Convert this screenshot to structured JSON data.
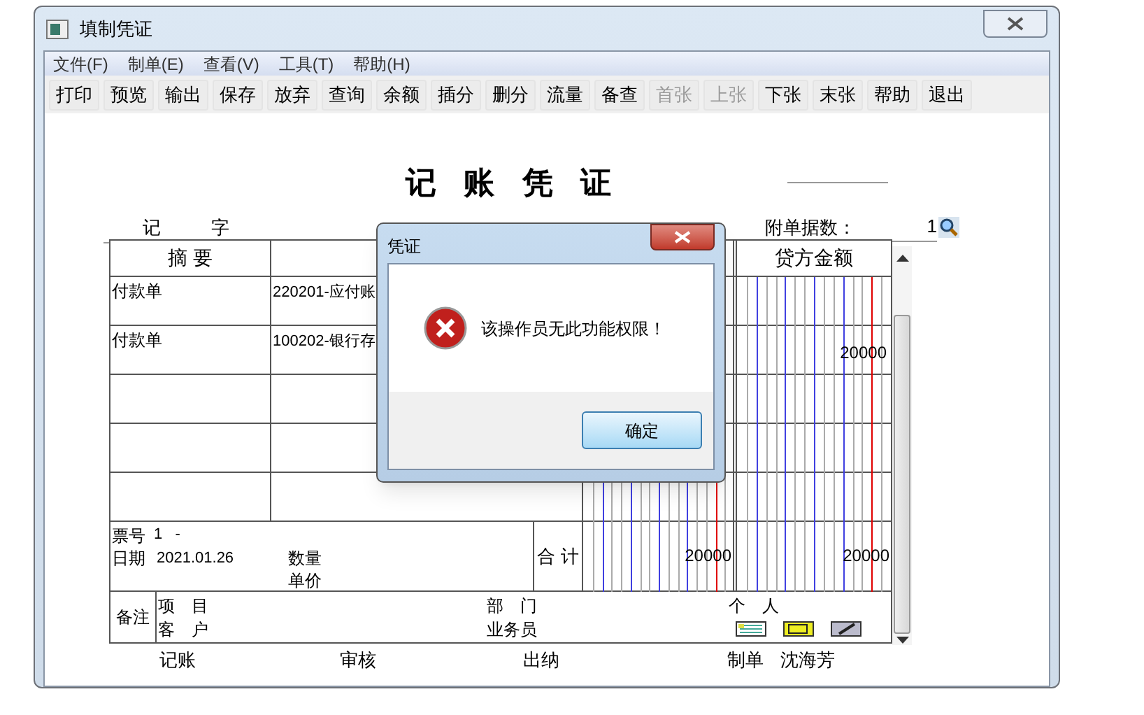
{
  "window": {
    "title": "填制凭证"
  },
  "menu": [
    "文件(F)",
    "制单(E)",
    "查看(V)",
    "工具(T)",
    "帮助(H)"
  ],
  "toolbar": [
    {
      "label": "打印",
      "disabled": false
    },
    {
      "label": "预览",
      "disabled": false
    },
    {
      "label": "输出",
      "disabled": false
    },
    {
      "label": "保存",
      "disabled": false
    },
    {
      "label": "放弃",
      "disabled": false
    },
    {
      "label": "查询",
      "disabled": false
    },
    {
      "label": "余额",
      "disabled": false
    },
    {
      "label": "插分",
      "disabled": false
    },
    {
      "label": "删分",
      "disabled": false
    },
    {
      "label": "流量",
      "disabled": false
    },
    {
      "label": "备查",
      "disabled": false
    },
    {
      "label": "首张",
      "disabled": true
    },
    {
      "label": "上张",
      "disabled": true
    },
    {
      "label": "下张",
      "disabled": false
    },
    {
      "label": "末张",
      "disabled": false
    },
    {
      "label": "帮助",
      "disabled": false
    },
    {
      "label": "退出",
      "disabled": false
    }
  ],
  "voucher": {
    "title": "记 账 凭 证",
    "type_char": "记",
    "type_suffix": "字",
    "attachments_label": "附单据数：",
    "attachments_value": "1",
    "columns": {
      "summary": "摘 要",
      "credit": "贷方金额"
    },
    "rows": [
      {
        "summary": "付款单",
        "account": "220201-应付账",
        "debit": "",
        "credit": ""
      },
      {
        "summary": "付款单",
        "account": "100202-银行存",
        "debit": "",
        "credit": "20000"
      },
      {
        "summary": "",
        "account": "",
        "debit": "",
        "credit": ""
      },
      {
        "summary": "",
        "account": "",
        "debit": "",
        "credit": ""
      },
      {
        "summary": "",
        "account": "",
        "debit": "",
        "credit": ""
      }
    ],
    "ticket_label": "票号",
    "ticket_value": "1   -",
    "date_field_label": "日期",
    "date_field_value": "2021.01.26",
    "quantity_label": "数量",
    "unit_price_label": "单价",
    "total_label": "合 计",
    "total_debit": "20000",
    "total_credit": "20000",
    "remarks_label": "备注",
    "project_label": "项　目",
    "customer_label": "客　户",
    "department_label": "部　门",
    "salesperson_label": "业务员",
    "person_label": "个　人",
    "signatures": [
      {
        "label": "记账"
      },
      {
        "label": "审核"
      },
      {
        "label": "出纳"
      },
      {
        "label": "制单",
        "value": "沈海芳"
      }
    ]
  },
  "dialog": {
    "title": "凭证",
    "message": "该操作员无此功能权限！",
    "ok_button": "确定"
  }
}
